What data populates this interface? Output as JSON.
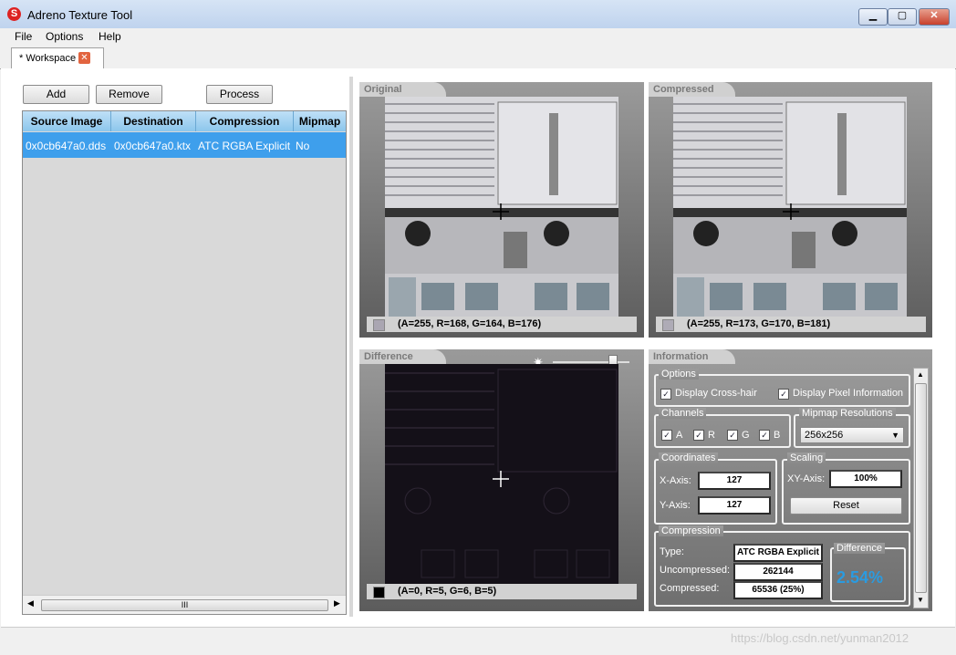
{
  "window": {
    "title": "Adreno Texture Tool",
    "min": "▁",
    "max": "▢",
    "close": "✕"
  },
  "menu": [
    "File",
    "Options",
    "Help"
  ],
  "tab": {
    "label": "* Workspace",
    "close": "✕"
  },
  "toolbar": {
    "add": "Add",
    "remove": "Remove",
    "process": "Process"
  },
  "grid": {
    "columns": [
      "Source Image",
      "Destination",
      "Compression",
      "Mipmap"
    ],
    "rows": [
      {
        "source": "0x0cb647a0.dds",
        "destination": "0x0cb647a0.ktx",
        "compression": "ATC RGBA Explicit",
        "mipmap": "No"
      }
    ],
    "scroll_grip": "III"
  },
  "panels": {
    "original": {
      "title": "Original",
      "pixel": "(A=255, R=168, G=164, B=176)",
      "swatch": "#aaa6b2"
    },
    "compressed": {
      "title": "Compressed",
      "pixel": "(A=255, R=173, G=170, B=181)",
      "swatch": "#aeabb6"
    },
    "difference": {
      "title": "Difference",
      "pixel": "(A=0, R=5, G=6, B=5)",
      "swatch": "#000000",
      "slider": 0.78
    }
  },
  "info": {
    "title": "Information",
    "options": {
      "title": "Options",
      "crosshair": "Display Cross-hair",
      "pixelinfo": "Display Pixel Information"
    },
    "channels": {
      "title": "Channels",
      "a": "A",
      "r": "R",
      "g": "G",
      "b": "B"
    },
    "mipmap": {
      "title": "Mipmap Resolutions",
      "value": "256x256"
    },
    "coords": {
      "title": "Coordinates",
      "x_label": "X-Axis:",
      "x": "127",
      "y_label": "Y-Axis:",
      "y": "127"
    },
    "scaling": {
      "title": "Scaling",
      "xy_label": "XY-Axis:",
      "xy": "100%",
      "reset": "Reset"
    },
    "compression": {
      "title": "Compression",
      "type_label": "Type:",
      "type": "ATC RGBA Explicit",
      "uncomp_label": "Uncompressed:",
      "uncomp": "262144",
      "comp_label": "Compressed:",
      "comp": "65536 (25%)",
      "diff_title": "Difference",
      "diff": "2.54%"
    }
  },
  "watermark": "https://blog.csdn.net/yunman2012",
  "colors": {
    "selection": "#3e9fec",
    "accent": "#2a9be0"
  }
}
